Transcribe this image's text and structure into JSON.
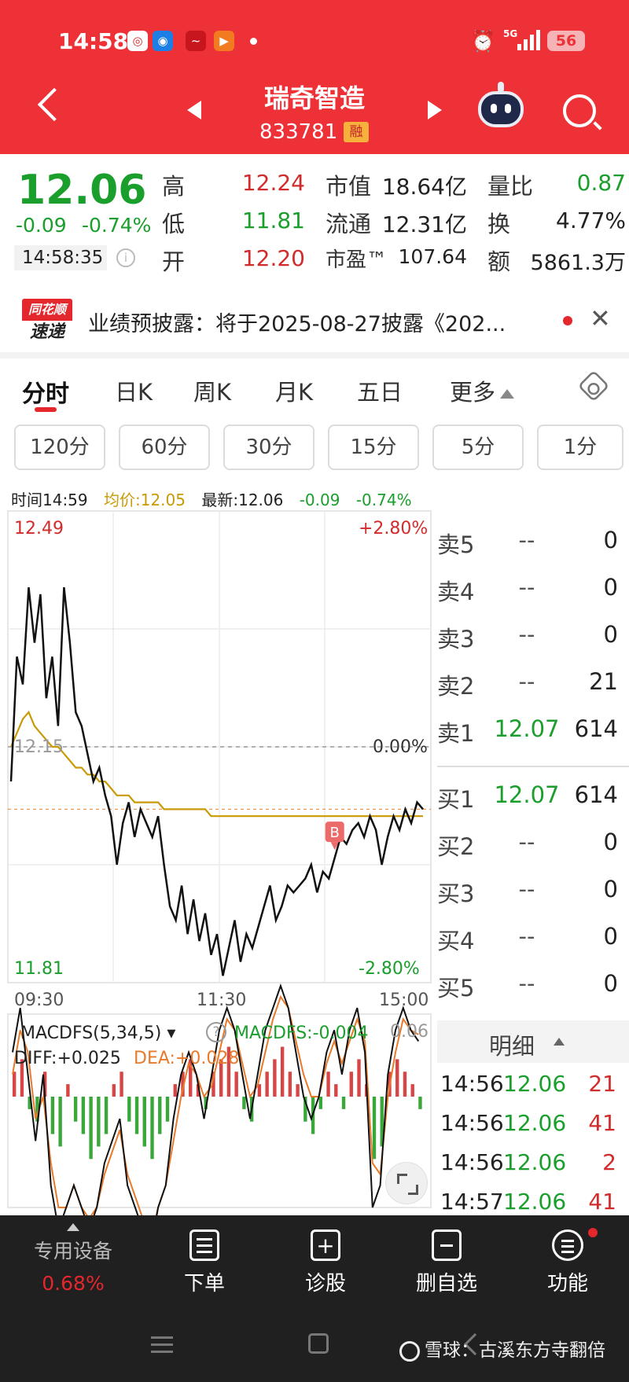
{
  "status_bar": {
    "time": "14:58",
    "network": "5G",
    "battery": "56"
  },
  "header": {
    "stock_name": "瑞奇智造",
    "stock_code": "833781",
    "margin_badge": "融"
  },
  "quote": {
    "price": "12.06",
    "change": "-0.09",
    "change_pct": "-0.74%",
    "time": "14:58:35",
    "high_label": "高",
    "high": "12.24",
    "low_label": "低",
    "low": "11.81",
    "open_label": "开",
    "open": "12.20",
    "mktcap_label": "市值",
    "mktcap": "18.64亿",
    "float_label": "流通",
    "float": "12.31亿",
    "pe_label": "市盈™",
    "pe": "107.64",
    "volratio_label": "量比",
    "volratio": "0.87",
    "turnover_label": "换",
    "turnover": "4.77%",
    "amount_label": "额",
    "amount": "5861.3万"
  },
  "news": {
    "logo_top": "同花顺",
    "logo_bottom": "速递",
    "text": "业绩预披露：将于2025-08-27披露《202..."
  },
  "tabs": [
    "分时",
    "日K",
    "周K",
    "月K",
    "五日",
    "更多"
  ],
  "periods": [
    "120分",
    "60分",
    "30分",
    "15分",
    "5分",
    "1分"
  ],
  "chart_header": {
    "time": "时间14:59",
    "avg": "均价:12.05",
    "latest": "最新:12.06",
    "chg": "-0.09",
    "chg_pct": "-0.74%"
  },
  "chart_data": {
    "type": "line",
    "y_left_top": "12.49",
    "y_left_bottom": "11.81",
    "y_right_top": "+2.80%",
    "y_right_mid": "0.00%",
    "y_right_bottom": "-2.80%",
    "prev_close_label": "12.15",
    "x_ticks": [
      "09:30",
      "11:30",
      "15:00"
    ],
    "ylim": [
      11.81,
      12.49
    ],
    "marker": "B",
    "series": [
      {
        "name": "价格",
        "values": [
          12.1,
          12.28,
          12.24,
          12.38,
          12.3,
          12.37,
          12.22,
          12.28,
          12.18,
          12.38,
          12.3,
          12.2,
          12.18,
          12.14,
          12.1,
          12.12,
          12.08,
          12.05,
          11.98,
          12.04,
          12.07,
          12.02,
          12.06,
          12.04,
          12.02,
          12.05,
          11.98,
          11.92,
          11.9,
          11.95,
          11.88,
          11.93,
          11.87,
          11.91,
          11.85,
          11.88,
          11.82,
          11.86,
          11.9,
          11.84,
          11.88,
          11.86,
          11.89,
          11.92,
          11.95,
          11.9,
          11.92,
          11.95,
          11.94,
          11.95,
          11.96,
          11.98,
          11.94,
          11.97,
          11.96,
          11.99,
          12.02,
          12.01,
          12.03,
          12.04,
          12.02,
          12.05,
          12.03,
          11.98,
          12.02,
          12.05,
          12.03,
          12.06,
          12.04,
          12.07,
          12.06
        ]
      },
      {
        "name": "均价",
        "values": [
          12.15,
          12.17,
          12.19,
          12.2,
          12.18,
          12.17,
          12.16,
          12.15,
          12.15,
          12.14,
          12.13,
          12.12,
          12.12,
          12.11,
          12.11,
          12.1,
          12.1,
          12.09,
          12.08,
          12.08,
          12.08,
          12.07,
          12.07,
          12.07,
          12.07,
          12.07,
          12.06,
          12.06,
          12.06,
          12.06,
          12.06,
          12.06,
          12.06,
          12.06,
          12.05,
          12.05,
          12.05,
          12.05,
          12.05,
          12.05,
          12.05,
          12.05,
          12.05,
          12.05,
          12.05,
          12.05,
          12.05,
          12.05,
          12.05,
          12.05,
          12.05,
          12.05,
          12.05,
          12.05,
          12.05,
          12.05,
          12.05,
          12.05,
          12.05,
          12.05,
          12.05,
          12.05,
          12.05,
          12.05,
          12.05,
          12.05,
          12.05,
          12.05,
          12.05,
          12.05,
          12.05
        ]
      }
    ]
  },
  "macd": {
    "name": "MACDFS(5,34,5)",
    "macdfs": "MACDFS:-0.004",
    "diff": "DIFF:+0.025",
    "dea": "DEA:+0.028",
    "scale": "0.06",
    "bars": [
      0.02,
      0.03,
      -0.01,
      -0.02,
      0.02,
      -0.03,
      -0.04,
      0.01,
      -0.02,
      -0.03,
      -0.05,
      -0.04,
      -0.03,
      0.01,
      0.02,
      -0.02,
      -0.03,
      -0.04,
      -0.05,
      -0.03,
      -0.02,
      0.01,
      0.02,
      0.03,
      0.01,
      -0.01,
      0.02,
      0.03,
      0.04,
      0.02,
      -0.01,
      -0.02,
      0.01,
      0.02,
      0.03,
      0.04,
      0.02,
      0.01,
      -0.02,
      -0.03,
      -0.01,
      0.02,
      0.01,
      -0.01,
      0.02,
      0.03,
      0.01,
      -0.05,
      -0.04,
      0.02,
      0.03,
      0.02,
      0.01,
      -0.01
    ],
    "diff_values": [
      0.02,
      0.04,
      0.01,
      -0.02,
      0.01,
      -0.04,
      -0.06,
      -0.05,
      -0.04,
      -0.05,
      -0.06,
      -0.05,
      -0.03,
      -0.02,
      -0.01,
      -0.04,
      -0.05,
      -0.06,
      -0.07,
      -0.05,
      -0.04,
      -0.01,
      0.01,
      0.02,
      0.01,
      -0.01,
      0.01,
      0.03,
      0.04,
      0.03,
      0.01,
      -0.01,
      0.01,
      0.03,
      0.04,
      0.05,
      0.04,
      0.02,
      0.0,
      -0.01,
      0.0,
      0.02,
      0.03,
      0.01,
      0.03,
      0.04,
      0.02,
      -0.05,
      -0.04,
      0.01,
      0.03,
      0.04,
      0.03,
      0.025
    ],
    "dea_values": [
      0.01,
      0.03,
      0.02,
      -0.01,
      0.0,
      -0.03,
      -0.05,
      -0.05,
      -0.04,
      -0.05,
      -0.055,
      -0.05,
      -0.035,
      -0.025,
      -0.015,
      -0.035,
      -0.045,
      -0.055,
      -0.065,
      -0.05,
      -0.04,
      -0.02,
      0.0,
      0.015,
      0.01,
      0.0,
      0.005,
      0.02,
      0.035,
      0.03,
      0.015,
      0.0,
      0.005,
      0.02,
      0.035,
      0.045,
      0.04,
      0.025,
      0.01,
      0.0,
      0.0,
      0.015,
      0.025,
      0.015,
      0.025,
      0.035,
      0.025,
      -0.03,
      -0.035,
      0.0,
      0.02,
      0.035,
      0.03,
      0.028
    ]
  },
  "order_book": {
    "asks": [
      {
        "label": "卖5",
        "price": "--",
        "vol": "0"
      },
      {
        "label": "卖4",
        "price": "--",
        "vol": "0"
      },
      {
        "label": "卖3",
        "price": "--",
        "vol": "0"
      },
      {
        "label": "卖2",
        "price": "--",
        "vol": "21"
      },
      {
        "label": "卖1",
        "price": "12.07",
        "vol": "614"
      }
    ],
    "bids": [
      {
        "label": "买1",
        "price": "12.07",
        "vol": "614"
      },
      {
        "label": "买2",
        "price": "--",
        "vol": "0"
      },
      {
        "label": "买3",
        "price": "--",
        "vol": "0"
      },
      {
        "label": "买4",
        "price": "--",
        "vol": "0"
      },
      {
        "label": "买5",
        "price": "--",
        "vol": "0"
      }
    ]
  },
  "details": {
    "title": "明细",
    "rows": [
      {
        "time": "14:56",
        "price": "12.06",
        "vol": "21"
      },
      {
        "time": "14:56",
        "price": "12.06",
        "vol": "41"
      },
      {
        "time": "14:56",
        "price": "12.06",
        "vol": "2"
      },
      {
        "time": "14:57",
        "price": "12.06",
        "vol": "41"
      }
    ]
  },
  "bottom_bar": {
    "special_label": "专用设备",
    "special_pct": "0.68%",
    "order": "下单",
    "diagnose": "诊股",
    "remove_watch": "删自选",
    "functions": "功能"
  },
  "watermark": "雪球：古溪东方寺翻倍",
  "colors": {
    "brand_red": "#ee3037",
    "up_red": "#d22b2b",
    "down_green": "#1a9e2c",
    "avg_gold": "#c99a06"
  }
}
